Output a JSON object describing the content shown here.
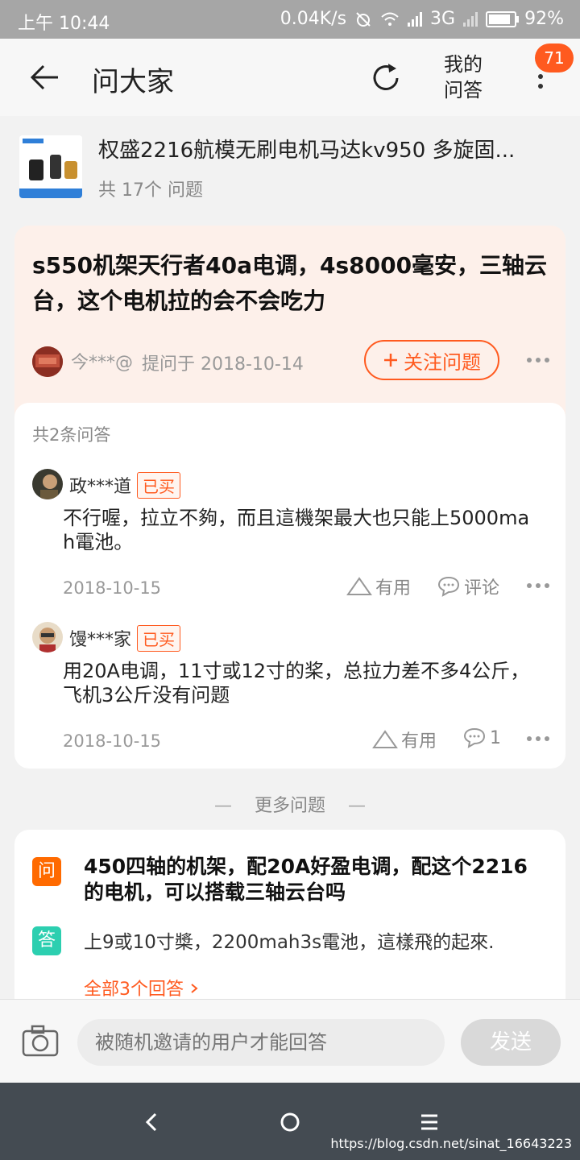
{
  "status_bar": {
    "time": "上午 10:44",
    "net_speed": "0.04K/s",
    "network": "3G",
    "battery": "92%"
  },
  "header": {
    "title": "问大家",
    "my_qa_line1": "我的",
    "my_qa_line2": "问答",
    "badge": "71"
  },
  "product": {
    "title": "权盛2216航模无刷电机马达kv950 多旋固...",
    "count": "共 17个 问题"
  },
  "question": {
    "title": "s550机架天行者40a电调，4s8000毫安，三轴云台，这个电机拉的会不会吃力",
    "asker": "今***@",
    "date": "提问于 2018-10-14",
    "follow_label": "关注问题"
  },
  "answers_section": {
    "count": "共2条问答",
    "answers": [
      {
        "user": "政***道",
        "tag": "已买",
        "text": "不行喔，拉立不夠，而且這機架最大也只能上5000mah電池。",
        "date": "2018-10-15",
        "useful": "有用",
        "comment": "评论"
      },
      {
        "user": "馒***家",
        "tag": "已买",
        "text": "用20A电调，11寸或12寸的桨，总拉力差不多4公斤，飞机3公斤没有问题",
        "date": "2018-10-15",
        "useful": "有用",
        "comment": "1"
      }
    ]
  },
  "more": {
    "label": "更多问题",
    "q_tag": "问",
    "a_tag": "答",
    "question": "450四轴的机架，配20A好盈电调，配这个2216的电机，可以搭载三轴云台吗",
    "answer": "上9或10寸槳，2200mah3s電池，這樣飛的起來.",
    "all_answers": "全部3个回答"
  },
  "input_bar": {
    "placeholder": "被随机邀请的用户才能回答",
    "send": "发送"
  },
  "watermark": "https://blog.csdn.net/sinat_16643223",
  "colors": {
    "accent": "#ff5a1f",
    "question_card_bg": "#fdf0ea",
    "q_tag": "#ff6a00",
    "a_tag": "#2ccfb0",
    "nav_bar": "#444b52"
  },
  "icons": [
    "back-arrow-icon",
    "refresh-icon",
    "more-vertical-icon",
    "plus-icon",
    "more-horizontal-icon",
    "thumb-triangle-icon",
    "comment-icon",
    "chevron-right-icon",
    "camera-icon",
    "nav-back-icon",
    "nav-home-icon",
    "nav-menu-icon"
  ]
}
